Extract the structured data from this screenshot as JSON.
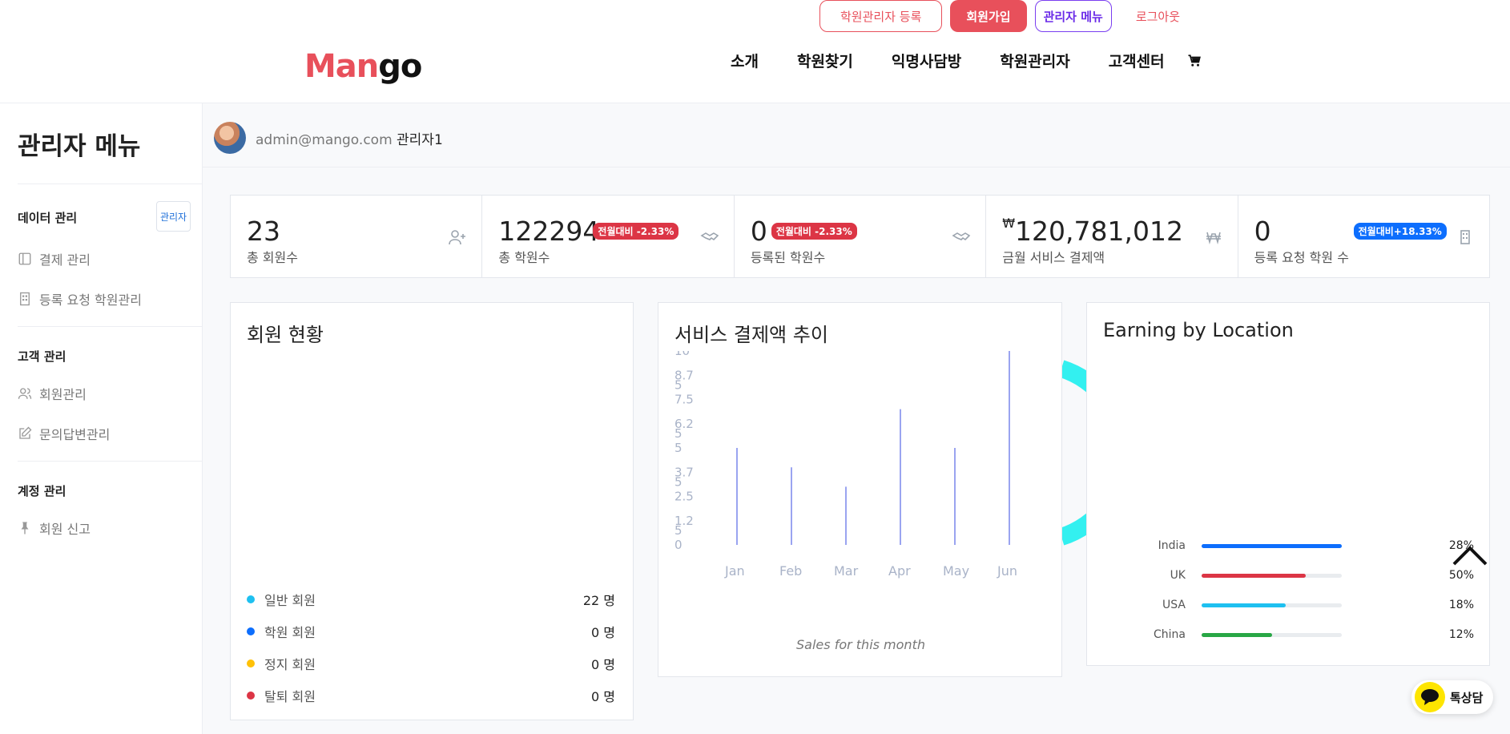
{
  "header": {
    "logo_man": "Man",
    "logo_go": "go",
    "actions": {
      "register_manager": "학원관리자 등록",
      "signup": "회원가입",
      "admin_menu": "관리자 메뉴",
      "logout": "로그아웃"
    },
    "nav": [
      "소개",
      "학원찾기",
      "익명사담방",
      "학원관리자",
      "고객센터"
    ]
  },
  "sidebar": {
    "title": "관리자 메뉴",
    "sections": [
      {
        "title": "데이터 관리",
        "badge": "관리자",
        "items": [
          {
            "label": "결제 관리",
            "icon": "layout-icon"
          },
          {
            "label": "등록 요청 학원관리",
            "icon": "building-icon"
          }
        ]
      },
      {
        "title": "고객 관리",
        "items": [
          {
            "label": "회원관리",
            "icon": "users-icon"
          },
          {
            "label": "문의답변관리",
            "icon": "edit-icon"
          }
        ]
      },
      {
        "title": "계정 관리",
        "items": [
          {
            "label": "회원 신고",
            "icon": "pin-icon"
          }
        ]
      }
    ]
  },
  "user": {
    "email": "admin@mango.com",
    "name": "관리자1"
  },
  "stats": [
    {
      "value": "23",
      "label": "총 회원수",
      "icon": "user-plus-icon"
    },
    {
      "value": "122294",
      "label": "총 학원수",
      "badge": "전월대비 -2.33%",
      "icon": "handshake-icon"
    },
    {
      "value": "0",
      "label": "등록된 학원수",
      "badge": "전월대비 -2.33%",
      "icon": "handshake-icon"
    },
    {
      "value_prefix": "₩",
      "value": "120,781,012",
      "label": "금월 서비스 결제액",
      "icon": "won-icon"
    },
    {
      "value": "0",
      "label": "등록 요청 학원 수",
      "badge": "전월대비+18.33%",
      "icon": "building-icon"
    }
  ],
  "members_card": {
    "title": "회원 현황",
    "legend": [
      {
        "label": "일반 회원",
        "value": "22 명",
        "color": "#1ec0f0"
      },
      {
        "label": "학원 회원",
        "value": "0 명",
        "color": "#0d6efd"
      },
      {
        "label": "정지 회원",
        "value": "0 명",
        "color": "#ffc107"
      },
      {
        "label": "탈퇴 회원",
        "value": "0 명",
        "color": "#dc3545"
      }
    ]
  },
  "sales_card": {
    "title": "서비스 결제액 추이",
    "caption": "Sales for this month"
  },
  "chart_data": {
    "type": "bar",
    "categories": [
      "Jan",
      "Feb",
      "Mar",
      "Apr",
      "May",
      "Jun"
    ],
    "values": [
      5,
      4,
      3,
      7,
      5,
      10
    ],
    "ylim": [
      0,
      10
    ],
    "yticks": [
      "0",
      "1.2\n5",
      "2.5",
      "3.7\n5",
      "5",
      "6.2\n5",
      "7.5",
      "8.7\n5",
      "10"
    ],
    "color": "#9aa4f0"
  },
  "location_card": {
    "title": "Earning by Location",
    "rows": [
      {
        "name": "India",
        "pct": "28%",
        "fill": 1.0,
        "color": "#0d6efd"
      },
      {
        "name": "UK",
        "pct": "50%",
        "fill": 0.74,
        "color": "#dc3545"
      },
      {
        "name": "USA",
        "pct": "18%",
        "fill": 0.6,
        "color": "#1ec0f0"
      },
      {
        "name": "China",
        "pct": "12%",
        "fill": 0.5,
        "color": "#28a745"
      }
    ]
  },
  "kakao": {
    "label": "톡상담"
  }
}
